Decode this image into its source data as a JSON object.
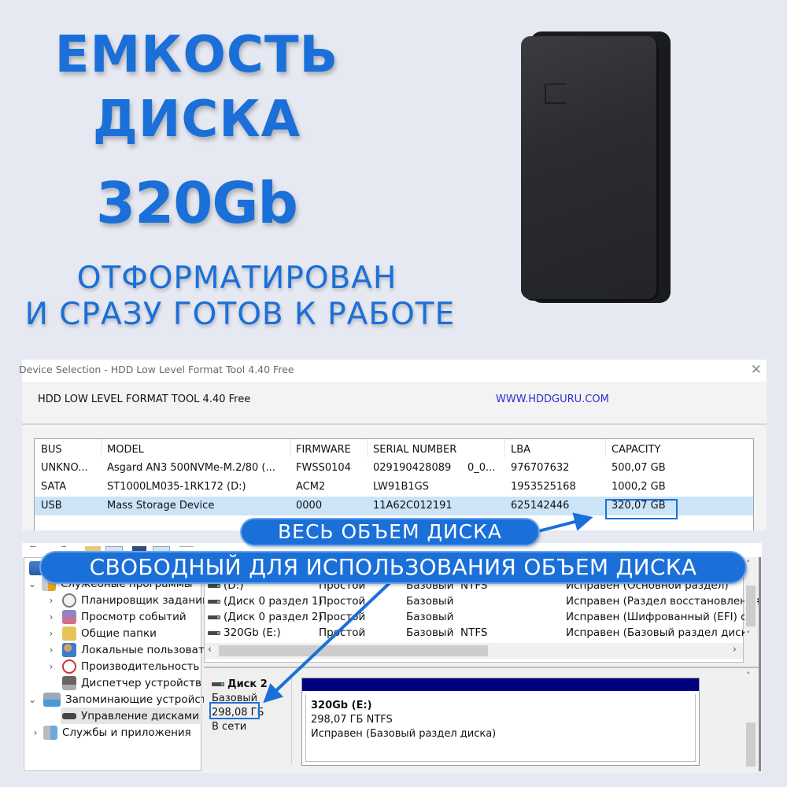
{
  "hero": {
    "line1": "ЕМКОСТЬ",
    "line2": "ДИСКА",
    "capacity": "320Gb",
    "sub1": "ОТФОРМАТИРОВАН",
    "sub2": "И СРАЗУ ГОТОВ К РАБОТЕ"
  },
  "colors": {
    "accent": "#1a6fd8",
    "background": "#e6e9f1",
    "selection": "#cce4f7",
    "partition_bar": "#000080",
    "link": "#2d2dd5"
  },
  "hdd_tool": {
    "window_title": "Device Selection - HDD Low Level Format Tool 4.40   Free",
    "app_name": "HDD LOW LEVEL FORMAT TOOL 4.40    Free",
    "website": "WWW.HDDGURU.COM",
    "close_icon": "close-icon",
    "columns": [
      "BUS",
      "MODEL",
      "FIRMWARE",
      "SERIAL NUMBER",
      "LBA",
      "CAPACITY"
    ],
    "rows": [
      {
        "bus": "UNKNO...",
        "model": "Asgard AN3 500NVMe-M.2/80 (...",
        "firmware": "FWSS0104",
        "serial": "029190428089",
        "serial_extra": "0_0...",
        "lba": "976707632",
        "capacity": "500,07 GB",
        "selected": false
      },
      {
        "bus": "SATA",
        "model": "ST1000LM035-1RK172 (D:)",
        "firmware": "ACM2",
        "serial": "LW91B1GS",
        "serial_extra": "",
        "lba": "1953525168",
        "capacity": "1000,2 GB",
        "selected": false
      },
      {
        "bus": "USB",
        "model": "Mass Storage Device",
        "firmware": "0000",
        "serial": "11A62C012191",
        "serial_extra": "",
        "lba": "625142446",
        "capacity": "320,07 GB",
        "selected": true
      }
    ]
  },
  "disk_mgmt": {
    "tree": [
      {
        "label": "Служебные программы",
        "icon": "tools-icon",
        "chevron": "expanded"
      },
      {
        "label": "Планировщик заданий",
        "icon": "clock-icon",
        "chevron": "collapsed"
      },
      {
        "label": "Просмотр событий",
        "icon": "event-viewer-icon",
        "chevron": "collapsed"
      },
      {
        "label": "Общие папки",
        "icon": "shared-folder-icon",
        "chevron": "collapsed"
      },
      {
        "label": "Локальные пользовате",
        "icon": "users-icon",
        "chevron": "collapsed"
      },
      {
        "label": "Производительность",
        "icon": "performance-icon",
        "chevron": "collapsed"
      },
      {
        "label": "Диспетчер устройств",
        "icon": "device-manager-icon",
        "chevron": "none"
      },
      {
        "label": "Запоминающие устройст",
        "icon": "storage-icon",
        "chevron": "expanded"
      },
      {
        "label": "Управление дисками",
        "icon": "disk-management-icon",
        "chevron": "none",
        "selected": true
      },
      {
        "label": "Службы и приложения",
        "icon": "services-icon",
        "chevron": "collapsed"
      }
    ],
    "volumes": [
      {
        "name": "(D:)",
        "layout": "Простой",
        "type": "Базовый",
        "fs": "NTFS",
        "status": "Исправен (Основной раздел)"
      },
      {
        "name": "(Диск 0 раздел 1)",
        "layout": "Простой",
        "type": "Базовый",
        "fs": "",
        "status": "Исправен (Раздел восстановления"
      },
      {
        "name": "(Диск 0 раздел 2)",
        "layout": "Простой",
        "type": "Базовый",
        "fs": "",
        "status": "Исправен (Шифрованный (EFI) си"
      },
      {
        "name": "320Gb (E:)",
        "layout": "Простой",
        "type": "Базовый",
        "fs": "NTFS",
        "status": "Исправен (Базовый раздел диска)"
      }
    ],
    "disk": {
      "name": "Диск 2",
      "type": "Базовый",
      "size": "298,08 ГБ",
      "state": "В сети"
    },
    "partition": {
      "name": "320Gb  (E:)",
      "size_fs": "298,07 ГБ NTFS",
      "status": "Исправен (Базовый раздел диска)"
    }
  },
  "callouts": {
    "total": "ВЕСЬ ОБЪЕМ  ДИСКА",
    "free": "СВОБОДНЫЙ ДЛЯ ИСПОЛЬЗОВАНИЯ ОБЪЕМ ДИСКА"
  }
}
